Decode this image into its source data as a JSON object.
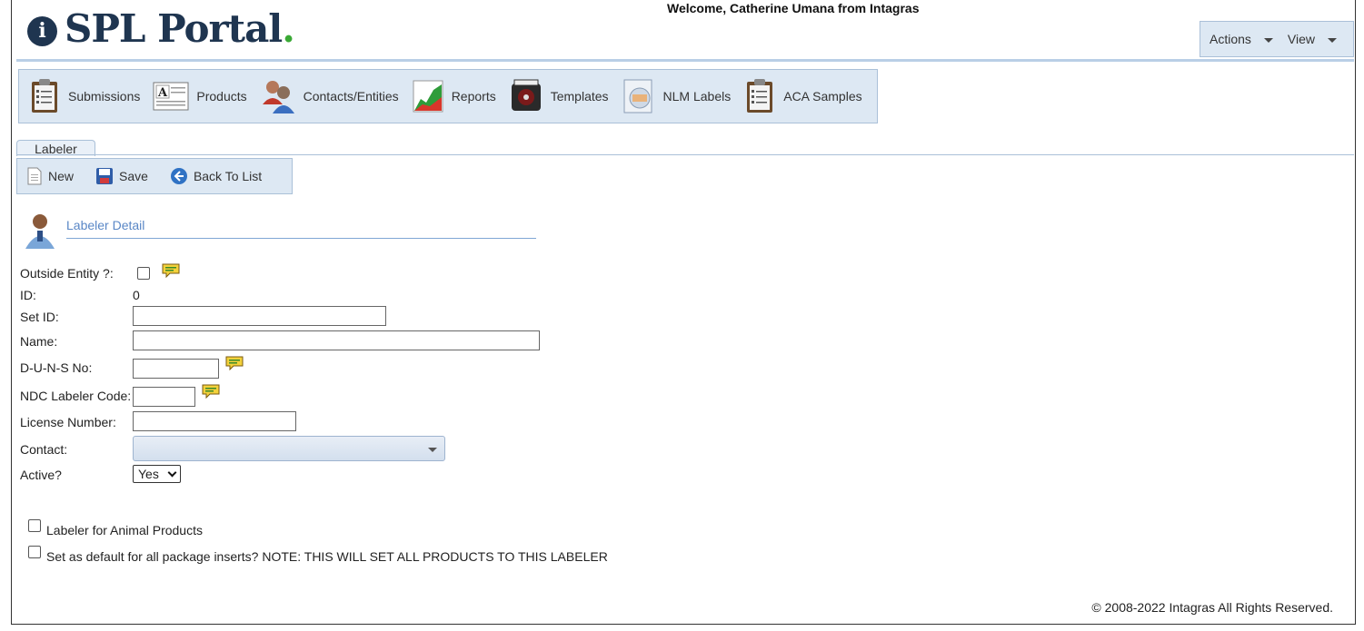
{
  "header": {
    "logo_letter": "i",
    "logo_text": "SPL Portal",
    "logo_dot": ".",
    "welcome": "Welcome, Catherine Umana from Intagras",
    "menu": [
      {
        "label": "Actions",
        "icon": "chevron-down-icon"
      },
      {
        "label": "View",
        "icon": "chevron-down-icon"
      }
    ]
  },
  "nav": {
    "items": [
      {
        "label": "Submissions",
        "icon": "clipboard-icon"
      },
      {
        "label": "Products",
        "icon": "document-a-icon"
      },
      {
        "label": "Contacts/Entities",
        "icon": "people-icon"
      },
      {
        "label": "Reports",
        "icon": "chart-icon"
      },
      {
        "label": "Templates",
        "icon": "film-reel-icon"
      },
      {
        "label": "NLM Labels",
        "icon": "label-document-icon"
      },
      {
        "label": "ACA Samples",
        "icon": "clipboard-icon"
      }
    ]
  },
  "tab": {
    "label": "Labeler"
  },
  "toolbar": {
    "new_label": "New",
    "save_label": "Save",
    "back_label": "Back To List"
  },
  "section": {
    "title": "Labeler Detail",
    "icon": "user-icon"
  },
  "form": {
    "outside_entity_label": "Outside Entity ?:",
    "id_label": "ID:",
    "id_value": "0",
    "set_id_label": "Set ID:",
    "set_id_value": "",
    "name_label": "Name:",
    "name_value": "",
    "duns_label": "D-U-N-S No:",
    "duns_value": "",
    "ndc_label": "NDC Labeler Code:",
    "ndc_value": "",
    "license_label": "License Number:",
    "license_value": "",
    "contact_label": "Contact:",
    "contact_value": "",
    "active_label": "Active?",
    "active_value": "Yes",
    "animal_label": "Labeler for Animal Products",
    "default_label": "Set as default for all package inserts? NOTE: THIS WILL SET ALL PRODUCTS TO THIS LABELER"
  },
  "footer": {
    "copyright": "© 2008-2022 Intagras All Rights Reserved."
  },
  "colors": {
    "brand_navy": "#1f3550",
    "brand_green": "#3aa935",
    "panel_bg": "#dde8f3",
    "panel_border": "#aac0d8",
    "section_title": "#5a87c6"
  }
}
